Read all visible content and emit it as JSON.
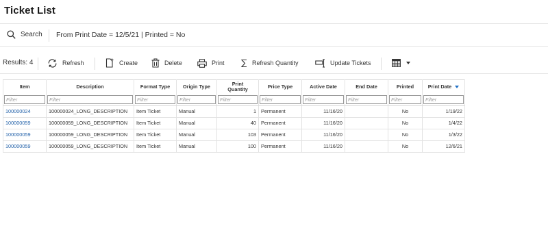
{
  "page": {
    "title": "Ticket List"
  },
  "search": {
    "label": "Search",
    "filter_summary": "From Print Date = 12/5/21 | Printed = No"
  },
  "toolbar": {
    "results": "Results: 4",
    "refresh": "Refresh",
    "create": "Create",
    "delete": "Delete",
    "print": "Print",
    "refresh_quantity": "Refresh Quantity",
    "update_tickets": "Update Tickets",
    "grid_menu_icon": "table-grid-icon"
  },
  "table": {
    "columns": {
      "item": "Item",
      "description": "Description",
      "format_type": "Format Type",
      "origin_type": "Origin Type",
      "print_quantity_1": "Print",
      "print_quantity_2": "Quantity",
      "price_type": "Price Type",
      "active_date": "Active Date",
      "end_date": "End Date",
      "printed": "Printed",
      "print_date": "Print Date"
    },
    "filter_placeholder": "Filter",
    "sorted_column": "Print Date",
    "sort_direction": "descending",
    "rows": [
      {
        "item": "100000024",
        "description": "100000024_LONG_DESCRIPTION",
        "format_type": "Item Ticket",
        "origin_type": "Manual",
        "print_quantity": "1",
        "price_type": "Permanent",
        "active_date": "11/16/20",
        "end_date": "",
        "printed": "No",
        "print_date": "1/19/22"
      },
      {
        "item": "100000059",
        "description": "100000059_LONG_DESCRIPTION",
        "format_type": "Item Ticket",
        "origin_type": "Manual",
        "print_quantity": "40",
        "price_type": "Permanent",
        "active_date": "11/16/20",
        "end_date": "",
        "printed": "No",
        "print_date": "1/4/22"
      },
      {
        "item": "100000059",
        "description": "100000059_LONG_DESCRIPTION",
        "format_type": "Item Ticket",
        "origin_type": "Manual",
        "print_quantity": "103",
        "price_type": "Permanent",
        "active_date": "11/16/20",
        "end_date": "",
        "printed": "No",
        "print_date": "1/3/22"
      },
      {
        "item": "100000059",
        "description": "100000059_LONG_DESCRIPTION",
        "format_type": "Item Ticket",
        "origin_type": "Manual",
        "print_quantity": "100",
        "price_type": "Permanent",
        "active_date": "11/16/20",
        "end_date": "",
        "printed": "No",
        "print_date": "12/6/21"
      }
    ]
  },
  "colors": {
    "link": "#1f5fa8",
    "sort_arrow": "#1f6fc5",
    "border": "#e2e2e2"
  }
}
